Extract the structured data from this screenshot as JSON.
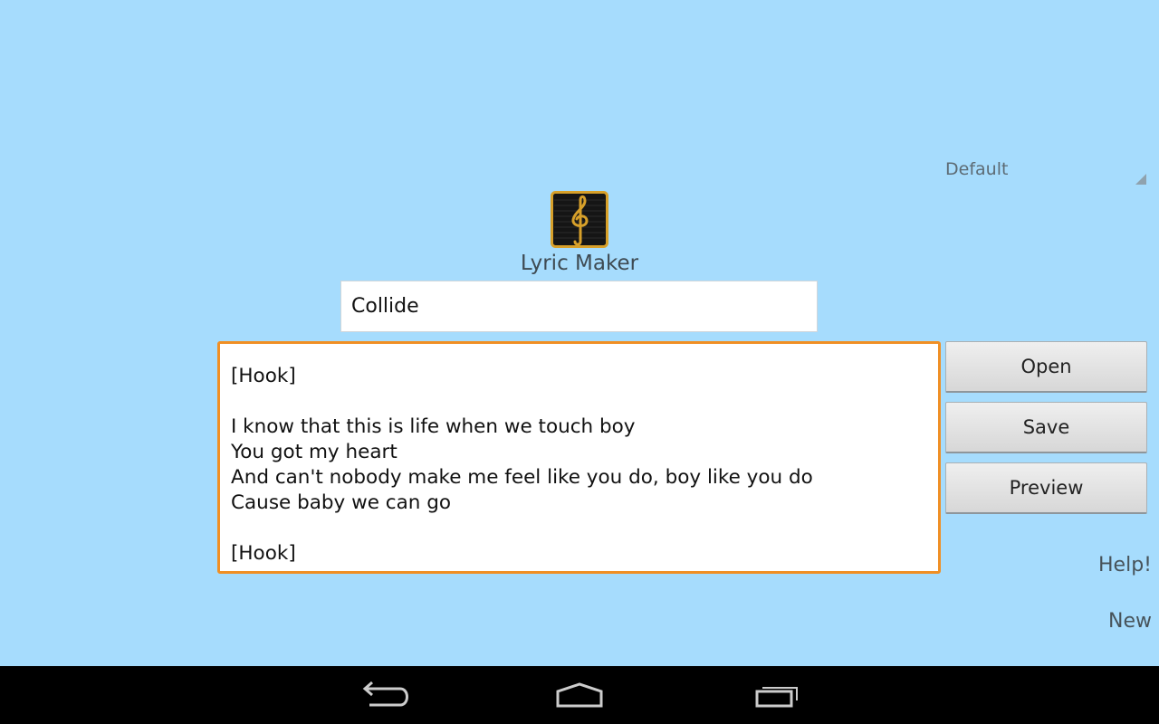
{
  "spinner": {
    "value": "Default"
  },
  "app": {
    "title": "Lyric Maker"
  },
  "song": {
    "title": "Collide",
    "lyrics": "[Hook]\n\nI know that this is life when we touch boy\nYou got my heart\nAnd can't nobody make me feel like you do, boy like you do\nCause baby we can go\n\n[Hook]"
  },
  "buttons": {
    "open": "Open",
    "save": "Save",
    "preview": "Preview"
  },
  "links": {
    "help": "Help!",
    "new": "New"
  },
  "icons": {
    "logo": "treble-clef-icon",
    "back": "back-icon",
    "home": "home-icon",
    "recents": "recent-apps-icon"
  },
  "colors": {
    "background": "#a6dcfd",
    "accent": "#f08f24",
    "logo_gold": "#d7a02a"
  }
}
